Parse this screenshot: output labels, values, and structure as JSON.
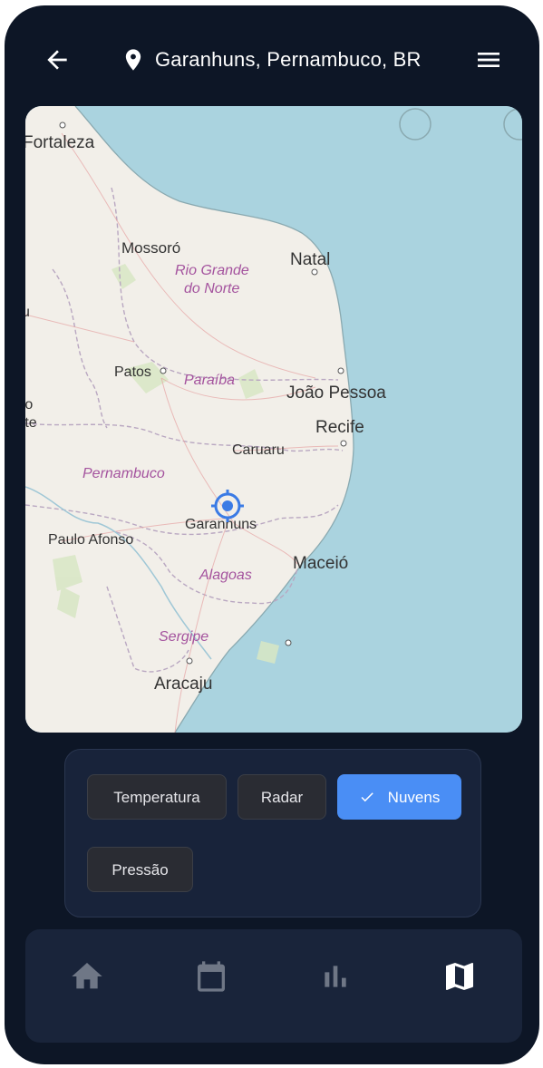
{
  "header": {
    "title": "Garanhuns, Pernambuco, BR",
    "back_icon": "arrow-left-icon",
    "location_icon": "location-pin-icon",
    "menu_icon": "hamburger-menu-icon"
  },
  "map": {
    "cities": {
      "fortaleza": "Fortaleza",
      "mossoro": "Mossoró",
      "natal": "Natal",
      "patos": "Patos",
      "joao_pessoa": "João Pessoa",
      "recife": "Recife",
      "caruaru": "Caruaru",
      "garanhuns": "Garanhuns",
      "paulo_afonso": "Paulo Afonso",
      "maceio": "Maceió",
      "aracaju": "Aracaju"
    },
    "states": {
      "rio_grande_1": "Rio Grande",
      "rio_grande_2": "do Norte",
      "paraiba": "Paraíba",
      "pernambuco": "Pernambuco",
      "alagoas": "Alagoas",
      "sergipe": "Sergipe"
    },
    "edge_fragments": {
      "left_top": "u",
      "left_mid1": "ro",
      "left_mid2": "rte"
    },
    "marker_icon": "crosshair-location-icon"
  },
  "layers": {
    "chips": [
      {
        "label": "Temperatura",
        "active": false
      },
      {
        "label": "Radar",
        "active": false
      },
      {
        "label": "Nuvens",
        "active": true
      },
      {
        "label": "Pressão",
        "active": false
      }
    ]
  },
  "nav": {
    "items": [
      "home-icon",
      "calendar-icon",
      "bar-chart-icon",
      "map-icon"
    ],
    "active_index": 3
  },
  "colors": {
    "background": "#0d1626",
    "card": "#18233a",
    "accent": "#4a8ef5",
    "chip": "#2a2c33",
    "water": "#aad3df",
    "land": "#f2efe9"
  }
}
